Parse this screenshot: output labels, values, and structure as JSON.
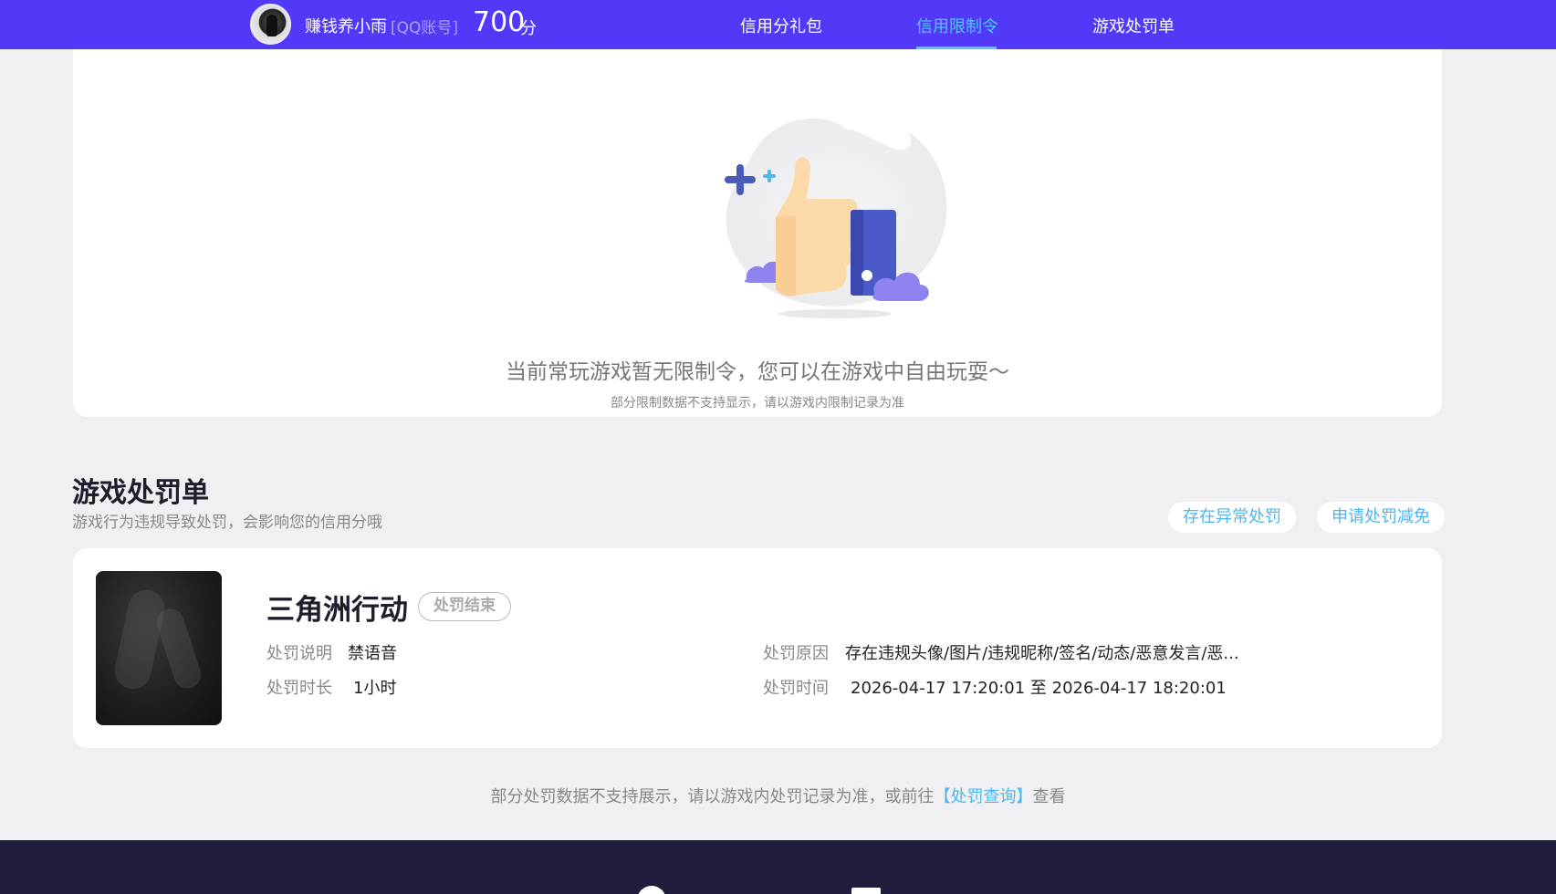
{
  "header": {
    "username": "赚钱养小雨",
    "account_tag": "[QQ账号]",
    "score": "700",
    "score_unit": "分",
    "tabs": [
      {
        "label": "信用分礼包",
        "active": false
      },
      {
        "label": "信用限制令",
        "active": true
      },
      {
        "label": "游戏处罚单",
        "active": false
      }
    ],
    "colors": {
      "bar": "#5238f7",
      "active": "#53c8ff"
    }
  },
  "restriction": {
    "illustration": "thumbs-up-icon",
    "empty_title": "当前常玩游戏暂无限制令，您可以在游戏中自由玩耍～",
    "empty_sub": "部分限制数据不支持显示，请以游戏内限制记录为准"
  },
  "penalty_section": {
    "title": "游戏处罚单",
    "subtitle": "游戏行为违规导致处罚，会影响您的信用分哦",
    "btn_abnormal": "存在异常处罚",
    "btn_reduce": "申请处罚减免"
  },
  "penalty": {
    "game": "三角洲行动",
    "status": "处罚结束",
    "desc_label": "处罚说明",
    "desc_value": "禁语音",
    "duration_label": "处罚时长",
    "duration_value": "1小时",
    "reason_label": "处罚原因",
    "reason_value": "存在违规头像/图片/违规昵称/签名/动态/恶意发言/恶...",
    "time_label": "处罚时间",
    "time_value": "2026-04-17 17:20:01 至 2026-04-17 18:20:01"
  },
  "footer": {
    "note_before": "部分处罚数据不支持展示，请以游戏内处罚记录为准，或前往",
    "link": "【处罚查询】",
    "note_after": "查看"
  }
}
